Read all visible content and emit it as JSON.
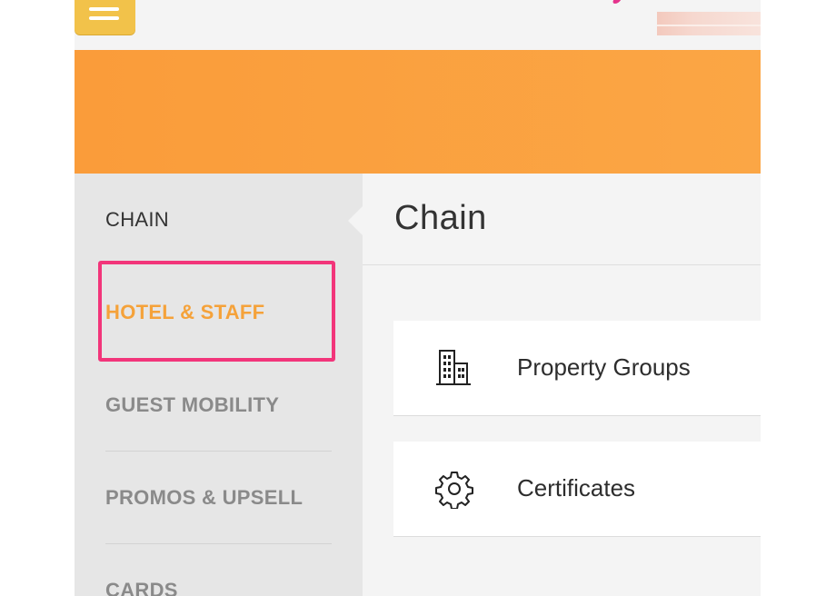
{
  "sidebar": {
    "items": [
      {
        "label": "CHAIN"
      },
      {
        "label": "HOTEL & STAFF"
      },
      {
        "label": "GUEST MOBILITY"
      },
      {
        "label": "PROMOS & UPSELL"
      },
      {
        "label": "CARDS"
      }
    ]
  },
  "main": {
    "title": "Chain",
    "cards": [
      {
        "label": "Property Groups",
        "icon": "building-icon"
      },
      {
        "label": "Certificates",
        "icon": "gear-icon"
      }
    ]
  },
  "colors": {
    "hero": "#fa9c3a",
    "highlight_text": "#f5a23a",
    "annotation_box": "#f2357a",
    "menu_button": "#f2c24a"
  }
}
